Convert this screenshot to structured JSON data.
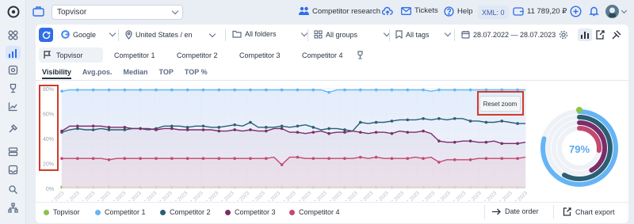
{
  "app": {
    "logo_icon": "topvisor-logo-icon"
  },
  "sidebar": {
    "items": [
      {
        "icon": "dashboard-icon"
      },
      {
        "icon": "positions-chart-icon",
        "active": true
      },
      {
        "icon": "snapshots-icon"
      },
      {
        "icon": "trophy-icon"
      },
      {
        "icon": "analytics-icon"
      },
      {
        "icon": "tools-icon"
      },
      {
        "icon": "server-icon"
      },
      {
        "icon": "inbox-icon"
      },
      {
        "icon": "audit-icon"
      },
      {
        "icon": "sitemap-icon"
      }
    ]
  },
  "topbar": {
    "project": "Topvisor",
    "competitor_research": "Competitor research",
    "tickets": "Tickets",
    "help": "Help",
    "xml": "XML: 0",
    "balance": "11 789,20 ₽"
  },
  "filters": {
    "engine": "Google",
    "region": "United States / en",
    "folders": "All folders",
    "groups": "All groups",
    "tags": "All tags",
    "dates": "28.07.2022 — 28.07.2023"
  },
  "competitors": [
    "Topvisor",
    "Competitor 1",
    "Competitor 2",
    "Competitor 3",
    "Competitor 4"
  ],
  "tabs": [
    "Visibility",
    "Avg.pos.",
    "Median",
    "TOP",
    "TOP %"
  ],
  "reset_zoom": "Reset zoom",
  "donut": {
    "value": "79%"
  },
  "legend": {
    "date_order": "Date order",
    "chart_export": "Chart export"
  },
  "chart_data": {
    "type": "line",
    "ylim": [
      0,
      80
    ],
    "yticks": [
      "0%",
      "20%",
      "40%",
      "60%",
      "80%"
    ],
    "x": [
      "28.06.2023",
      "29.06.2023",
      "30.06.2023",
      "01.07.2023",
      "02.07.2023",
      "03.07.2023",
      "04.07.2023",
      "05.07.2023",
      "06.07.2023",
      "07.07.2023",
      "08.07.2023",
      "09.07.2023",
      "10.07.2023",
      "11.07.2023",
      "12.07.2023",
      "13.07.2023",
      "14.07.2023",
      "15.07.2023",
      "16.07.2023",
      "17.07.2023",
      "18.07.2023",
      "19.07.2023",
      "20.07.2023",
      "21.07.2023",
      "22.07.2023",
      "23.07.2023",
      "24.07.2023",
      "25.07.2023",
      "26.07.2023",
      "27.07.2023",
      "28.07.2023"
    ],
    "xtick_labels": [
      "28.06.2023",
      "29.06.2023",
      "30.06.2023",
      "01.07.2023",
      "02.07.2023",
      "03.07.2023",
      "04.07.2023",
      "05.07.2023",
      "06.07.2023",
      "07.07.2023",
      "08.07.2023",
      "09.07.2023",
      "10.07.2023",
      "11.07.2023",
      "12.07.2023",
      "13.07.2023",
      "14.07.2023",
      "15.07.2023",
      "16.07.2023",
      "17.07.2023",
      "18.07.2023",
      "19.07.2023",
      "20.07.2023",
      "21.07.2023",
      "22.07.2023",
      "23.07.2023",
      "24.07.2023",
      "25.07.2023",
      "26.07.2023",
      "27.07.2023",
      "28.07.2023"
    ],
    "series": [
      {
        "name": "Topvisor",
        "color": "#8bc34a",
        "values": [
          1,
          1,
          1,
          1,
          1,
          1,
          1,
          1,
          1,
          1,
          1,
          1,
          1,
          1,
          1,
          1,
          1,
          1,
          1,
          1,
          1,
          1,
          1,
          1,
          1,
          1,
          1,
          1,
          1,
          1,
          1,
          1,
          1,
          1,
          1,
          1,
          1,
          1,
          1,
          1,
          1,
          1,
          1,
          1,
          1,
          1,
          1,
          1,
          1,
          1,
          1,
          1,
          1,
          1,
          1,
          1,
          1,
          1,
          1,
          1
        ]
      },
      {
        "name": "Competitor 1",
        "color": "#64b5f6",
        "values": [
          78,
          79,
          79,
          79,
          79,
          79,
          79,
          79,
          79,
          79,
          79,
          79,
          79,
          79,
          79,
          79,
          79,
          79,
          79,
          79,
          79,
          79,
          79,
          79,
          79,
          79,
          79,
          79,
          79,
          79,
          79,
          79,
          79,
          79,
          77,
          79,
          79,
          79,
          79,
          79,
          79,
          79,
          79,
          79,
          79,
          79,
          79,
          78,
          79,
          79,
          79,
          79,
          79,
          79,
          79,
          79,
          79,
          79,
          79,
          79
        ]
      },
      {
        "name": "Competitor 2",
        "color": "#2b5f73",
        "values": [
          45,
          47,
          48,
          47,
          47,
          48,
          47,
          47,
          47,
          48,
          48,
          47,
          48,
          50,
          50,
          50,
          49,
          50,
          50,
          49,
          49,
          50,
          51,
          50,
          53,
          49,
          49,
          49,
          50,
          49,
          50,
          51,
          49,
          47,
          48,
          48,
          47,
          46,
          53,
          52,
          53,
          53,
          54,
          55,
          55,
          55,
          56,
          55,
          56,
          55,
          56,
          56,
          54,
          54,
          53,
          53,
          54,
          53,
          52,
          52
        ]
      },
      {
        "name": "Competitor 3",
        "color": "#7b2d6b",
        "values": [
          46,
          50,
          50,
          50,
          50,
          50,
          49,
          49,
          49,
          48,
          48,
          48,
          47,
          48,
          48,
          47,
          47,
          47,
          47,
          47,
          46,
          46,
          47,
          46,
          47,
          46,
          46,
          48,
          48,
          45,
          45,
          44,
          45,
          46,
          44,
          45,
          45,
          46,
          45,
          44,
          45,
          45,
          44,
          46,
          45,
          45,
          46,
          44,
          38,
          37,
          37,
          38,
          38,
          37,
          37,
          38,
          36,
          36,
          36,
          37
        ]
      },
      {
        "name": "Competitor 4",
        "color": "#c2496f",
        "values": [
          24,
          24,
          24,
          24,
          24,
          24,
          23,
          24,
          24,
          24,
          24,
          24,
          24,
          24,
          24,
          24,
          24,
          24,
          24,
          24,
          24,
          24,
          24,
          24,
          24,
          24,
          24,
          25,
          19,
          25,
          25,
          24,
          24,
          24,
          24,
          24,
          24,
          24,
          25,
          24,
          25,
          24,
          24,
          24,
          24,
          25,
          24,
          25,
          21,
          23,
          23,
          23,
          23,
          24,
          24,
          24,
          24,
          24,
          24,
          25
        ]
      }
    ]
  }
}
